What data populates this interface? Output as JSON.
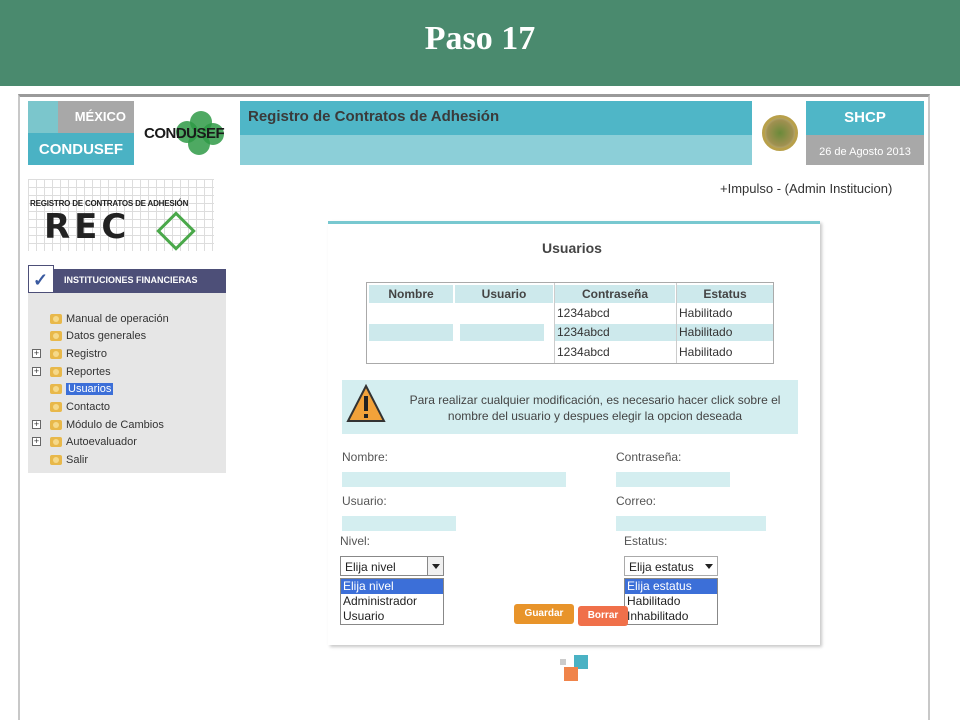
{
  "slide": {
    "title": "Paso 17"
  },
  "header": {
    "mexico": "MÉXICO",
    "condusef": "CONDUSEF",
    "logo_text": "CONDUSEF",
    "app_title": "Registro de Contratos de Adhesión",
    "shcp": "SHCP",
    "date": "26 de Agosto 2013"
  },
  "reca": {
    "caption": "REGISTRO DE CONTRATOS DE ADHESIÓN",
    "word": "REC"
  },
  "sidebar": {
    "section_label": "INSTITUCIONES FINANCIERAS",
    "items": [
      {
        "label": "Manual de operación"
      },
      {
        "label": "Datos generales"
      },
      {
        "label": "Registro"
      },
      {
        "label": "Reportes"
      },
      {
        "label": "Usuarios"
      },
      {
        "label": "Contacto"
      },
      {
        "label": "Módulo de Cambios"
      },
      {
        "label": "Autoevaluador"
      },
      {
        "label": "Salir"
      }
    ]
  },
  "user_info": "+Impulso -   (Admin Institucion)",
  "panel": {
    "title": "Usuarios",
    "table": {
      "headers": [
        "Nombre",
        "Usuario",
        "Contraseña",
        "Estatus"
      ],
      "rows": [
        {
          "nombre": "",
          "usuario": "",
          "contrasena": "1234abcd",
          "estatus": "Habilitado"
        },
        {
          "nombre": "",
          "usuario": "",
          "contrasena": "1234abcd",
          "estatus": "Habilitado"
        },
        {
          "nombre": "",
          "usuario": "",
          "contrasena": "1234abcd",
          "estatus": "Habilitado"
        }
      ]
    },
    "warning": "Para realizar cualquier modificación, es necesario hacer click sobre el nombre del usuario y despues elegir la opcion deseada",
    "form": {
      "nombre_label": "Nombre:",
      "contrasena_label": "Contraseña:",
      "usuario_label": "Usuario:",
      "correo_label": "Correo:",
      "nivel_label": "Nivel:",
      "estatus_label": "Estatus:",
      "nivel_selected": "Elija nivel",
      "nivel_options": [
        "Elija nivel",
        "Administrador",
        "Usuario"
      ],
      "estatus_selected": "Elija estatus",
      "estatus_options": [
        "Elija estatus",
        "Habilitado",
        "Inhabilitado"
      ]
    },
    "buttons": {
      "guardar": "Guardar",
      "borrar": "Borrar"
    }
  }
}
